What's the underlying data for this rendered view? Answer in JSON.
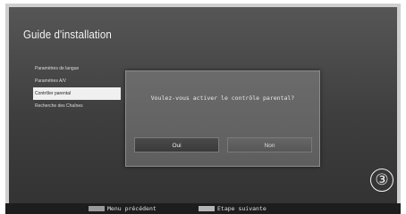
{
  "screen": {
    "title": "Guide d'installation",
    "step_number": "③"
  },
  "menu": {
    "items": [
      {
        "label": "Paramètres de langue"
      },
      {
        "label": "Paramètres A/V"
      },
      {
        "label": "Contrôler parental"
      },
      {
        "label": "Recherche des Chaînes"
      }
    ],
    "selected_index": 2
  },
  "dialog": {
    "message": "Voulez-vous activer le contrôle parental?",
    "yes_label": "Oui",
    "no_label": "Non"
  },
  "footer": {
    "prev_label": "Menu précédent",
    "next_label": "Etape suivante",
    "prev_key_color": "#9a9a9a",
    "next_key_color": "#b5b5b5"
  }
}
